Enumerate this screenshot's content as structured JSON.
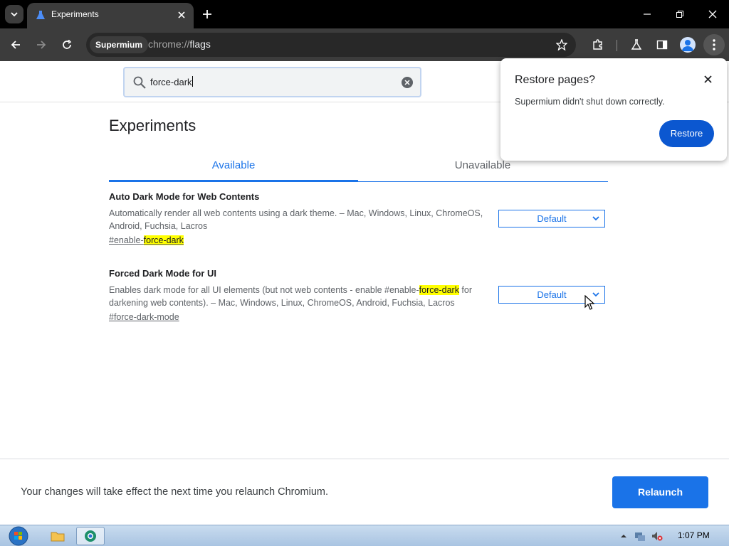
{
  "window": {
    "tab_title": "Experiments"
  },
  "toolbar": {
    "chip_label": "Supermium",
    "url_scheme": "chrome://",
    "url_host": "flags"
  },
  "search": {
    "value": "force-dark"
  },
  "page": {
    "title": "Experiments",
    "tabs": [
      {
        "label": "Available"
      },
      {
        "label": "Unavailable"
      }
    ]
  },
  "flags": [
    {
      "name": "Auto Dark Mode for Web Contents",
      "desc": "Automatically render all web contents using a dark theme. – Mac, Windows, Linux, ChromeOS, Android, Fuchsia, Lacros",
      "link_prefix": "#enable-",
      "link_highlight": "force-dark",
      "select_value": "Default"
    },
    {
      "name": "Forced Dark Mode for UI",
      "desc_before": "Enables dark mode for all UI elements (but not web contents - enable #enable-",
      "desc_highlight": "force-dark",
      "desc_after": " for darkening web contents). – Mac, Windows, Linux, ChromeOS, Android, Fuchsia, Lacros",
      "link": "#force-dark-mode",
      "select_value": "Default"
    }
  ],
  "popup": {
    "title": "Restore pages?",
    "message": "Supermium didn't shut down correctly.",
    "button": "Restore"
  },
  "footer": {
    "message": "Your changes will take effect the next time you relaunch Chromium.",
    "button": "Relaunch"
  },
  "taskbar": {
    "clock": "1:07 PM"
  },
  "colors": {
    "accent": "#1a73e8",
    "popup_button": "#0b57d0",
    "highlight": "#ffff00"
  }
}
